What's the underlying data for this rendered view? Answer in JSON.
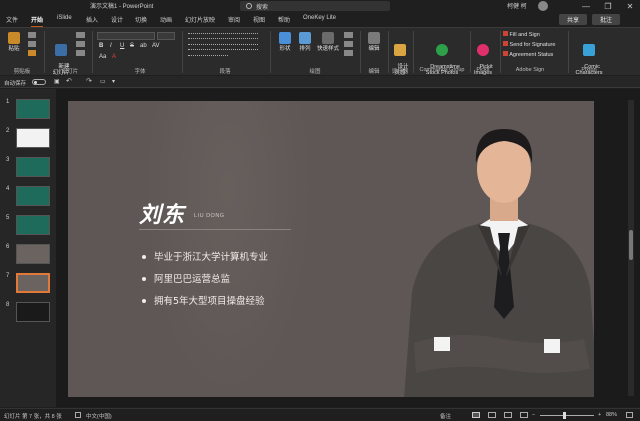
{
  "titlebar": {
    "doc_title": "演示文稿1 - PowerPoint",
    "search_placeholder": "搜索",
    "user": "柯健 柯",
    "min": "—",
    "restore": "❐",
    "close": "✕"
  },
  "tabs": [
    "文件",
    "开始",
    "iSlide",
    "插入",
    "设计",
    "切换",
    "动画",
    "幻灯片放映",
    "审阅",
    "视图",
    "帮助",
    "OneKey Lite"
  ],
  "active_tab": 1,
  "share_label": "共享",
  "comment_label": "批注",
  "ribbon": {
    "groups": {
      "clipboard": "剪贴板",
      "slides": "幻灯片",
      "font": "字体",
      "paragraph": "段落",
      "drawing": "绘图",
      "editing": "编辑",
      "designer": "设计器",
      "commands": "Commands Group",
      "pickit": "Pickit",
      "adobe": "Adobe Sign",
      "pixton": "Pixton"
    },
    "buttons": {
      "paste": "粘贴",
      "new_slide": "新建\n幻灯片",
      "shape": "形状",
      "arrange": "排列",
      "quick_styles": "快速样式",
      "editing": "编辑",
      "design_ideas": "设计\n灵感",
      "dreamstime": "Dreamstime\nStock Photos",
      "pickit_images": "Pickit\nImages",
      "fill_sign": "Fill and Sign",
      "send_sign": "Send for Signature",
      "agreement": "Agreement Status",
      "comic": "Comic\nCharacters"
    },
    "format": [
      "B",
      "I",
      "U",
      "S",
      "ab",
      "AV",
      "Aa",
      "A"
    ]
  },
  "qat": {
    "autosave": "自动保存",
    "autosave_state": "关"
  },
  "thumbnails": [
    {
      "num": "1",
      "color": "#1e6b5c"
    },
    {
      "num": "2",
      "color": "#f2f2f2"
    },
    {
      "num": "3",
      "color": "#1e6b5c"
    },
    {
      "num": "4",
      "color": "#1e6b5c"
    },
    {
      "num": "5",
      "color": "#1e6b5c"
    },
    {
      "num": "6",
      "color": "#6b6360"
    },
    {
      "num": "7",
      "color": "#6b6360"
    },
    {
      "num": "8",
      "color": "#1a1a1a"
    }
  ],
  "selected_slide": 7,
  "slide": {
    "name": "刘东",
    "name_en": "LIU DONG",
    "bullets": [
      "毕业于浙江大学计算机专业",
      "阿里巴巴运营总监",
      "拥有5年大型项目操盘经验"
    ]
  },
  "status": {
    "slide_info": "幻灯片 第 7 张，共 8 张",
    "language": "中文(中国)",
    "notes": "备注",
    "zoom": "88%",
    "zoom_value": 0.88
  },
  "colors": {
    "accent": "#c55a11",
    "slide_bg": "#5e5755"
  }
}
